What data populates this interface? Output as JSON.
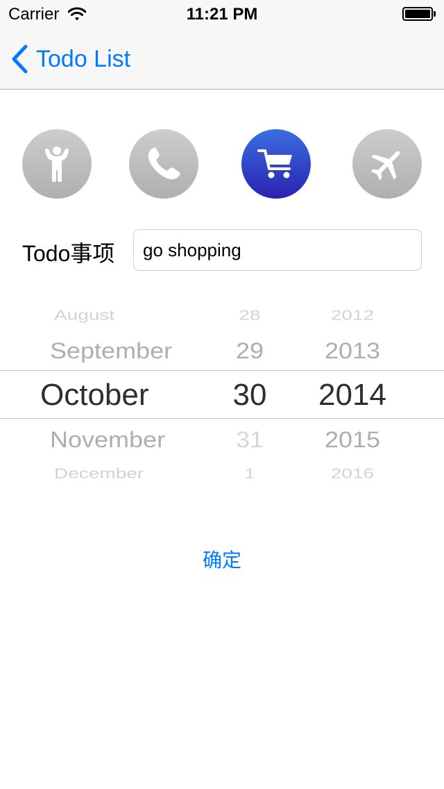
{
  "status_bar": {
    "carrier": "Carrier",
    "time": "11:21 PM",
    "icons": [
      "wifi-icon",
      "battery-icon"
    ]
  },
  "nav": {
    "back_label": "Todo List",
    "back_icon": "chevron-left-icon"
  },
  "categories": [
    {
      "name": "person",
      "icon": "person-icon",
      "selected": false
    },
    {
      "name": "phone",
      "icon": "phone-icon",
      "selected": false
    },
    {
      "name": "shopping",
      "icon": "shopping-cart-icon",
      "selected": true
    },
    {
      "name": "travel",
      "icon": "airplane-icon",
      "selected": false
    }
  ],
  "todo": {
    "label": "Todo事项",
    "value": "go shopping"
  },
  "date_picker": {
    "months": [
      "August",
      "September",
      "October",
      "November",
      "December"
    ],
    "days": [
      "28",
      "29",
      "30",
      "31",
      "1"
    ],
    "years": [
      "2012",
      "2013",
      "2014",
      "2015",
      "2016"
    ],
    "selected": {
      "month": "October",
      "day": "30",
      "year": "2014"
    }
  },
  "confirm_label": "确定",
  "colors": {
    "accent": "#007aff",
    "selected_gradient_top": "#3a6ee0",
    "selected_gradient_bottom": "#2a22b0",
    "unselected": "#bdbdbd"
  }
}
